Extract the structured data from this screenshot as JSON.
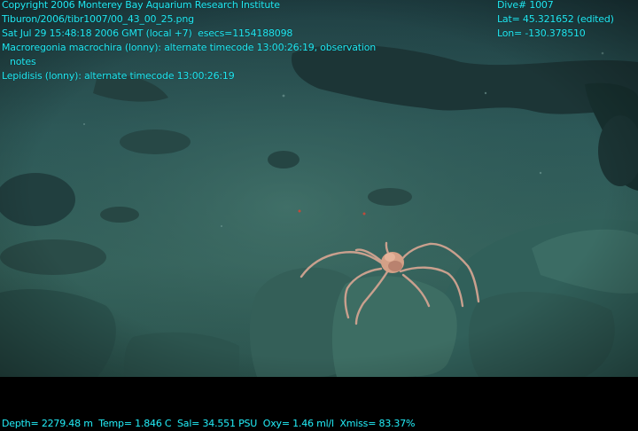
{
  "overlay": {
    "copyright": "Copyright 2006 Monterey Bay Aquarium Research Institute",
    "filename": "Tiburon/2006/tibr1007/00_43_00_25.png",
    "datetime": "Sat Jul 29 15:48:18 2006 GMT (local +7)  esecs=1154188098",
    "annotation_1": "Macroregonia macrochira (lonny): alternate timecode 13:00:26:19, observation",
    "annotation_1_cont": "notes",
    "annotation_2": "Lepidisis (lonny): alternate timecode 13:00:26:19",
    "dive": "Dive# 1007",
    "lat": "Lat= 45.321652 (edited)",
    "lon": "Lon= -130.378510",
    "sensors": "Depth= 2279.48 m  Temp= 1.846 C  Sal= 34.551 PSU  Oxy= 1.46 ml/l  Xmiss= 83.37%"
  },
  "colors": {
    "overlay_text": "#22e6f0",
    "water": "#2a5e5e",
    "seafloor": "#3a6a64",
    "crab": "#c8a08c"
  }
}
